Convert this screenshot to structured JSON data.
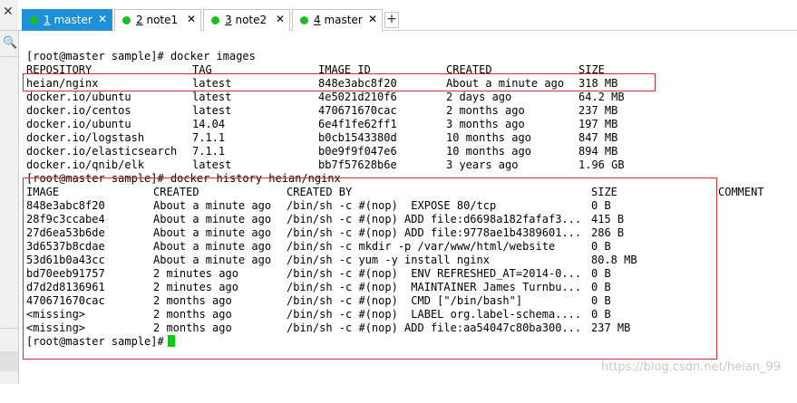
{
  "tabs": [
    {
      "num": "1",
      "name": "master",
      "active": true
    },
    {
      "num": "2",
      "name": "note1",
      "active": false
    },
    {
      "num": "3",
      "name": "note2",
      "active": false
    },
    {
      "num": "4",
      "name": "master",
      "active": false
    }
  ],
  "sidebar": {
    "close_glyph": "✕",
    "search_glyph": "🔍"
  },
  "add_tab_label": "+",
  "terminal": {
    "cmd_images": "[root@master sample]# docker images",
    "images_headers": [
      "REPOSITORY",
      "TAG",
      "IMAGE ID",
      "CREATED",
      "SIZE"
    ],
    "images_rows": [
      [
        "heian/nginx",
        "latest",
        "848e3abc8f20",
        "About a minute ago",
        "318 MB"
      ],
      [
        "docker.io/ubuntu",
        "latest",
        "4e5021d210f6",
        "2 days ago",
        "64.2 MB"
      ],
      [
        "docker.io/centos",
        "latest",
        "470671670cac",
        "2 months ago",
        "237 MB"
      ],
      [
        "docker.io/ubuntu",
        "14.04",
        "6e4f1fe62ff1",
        "3 months ago",
        "197 MB"
      ],
      [
        "docker.io/logstash",
        "7.1.1",
        "b0cb1543380d",
        "10 months ago",
        "847 MB"
      ],
      [
        "docker.io/elasticsearch",
        "7.1.1",
        "b0e9f9f047e6",
        "10 months ago",
        "894 MB"
      ],
      [
        "docker.io/qnib/elk",
        "latest",
        "bb7f57628b6e",
        "3 years ago",
        "1.96 GB"
      ]
    ],
    "cmd_history": "[root@master sample]# docker history heian/nginx",
    "history_headers": [
      "IMAGE",
      "CREATED",
      "CREATED BY",
      "SIZE",
      "COMMENT"
    ],
    "history_rows": [
      [
        "848e3abc8f20",
        "About a minute ago",
        "/bin/sh -c #(nop)  EXPOSE 80/tcp",
        "0 B"
      ],
      [
        "28f9c3ccabe4",
        "About a minute ago",
        "/bin/sh -c #(nop) ADD file:d6698a182fafaf3...",
        "415 B"
      ],
      [
        "27d6ea53b6de",
        "About a minute ago",
        "/bin/sh -c #(nop) ADD file:9778ae1b4389601...",
        "286 B"
      ],
      [
        "3d6537b8cdae",
        "About a minute ago",
        "/bin/sh -c mkdir -p /var/www/html/website",
        "0 B"
      ],
      [
        "53d61b0a43cc",
        "About a minute ago",
        "/bin/sh -c yum -y install nginx",
        "80.8 MB"
      ],
      [
        "bd70eeb91757",
        "2 minutes ago",
        "/bin/sh -c #(nop)  ENV REFRESHED_AT=2014-0...",
        "0 B"
      ],
      [
        "d7d2d8136961",
        "2 minutes ago",
        "/bin/sh -c #(nop)  MAINTAINER James Turnbu...",
        "0 B"
      ],
      [
        "470671670cac",
        "2 months ago",
        "/bin/sh -c #(nop)  CMD [\"/bin/bash\"]",
        "0 B"
      ],
      [
        "<missing>",
        "2 months ago",
        "/bin/sh -c #(nop)  LABEL org.label-schema....",
        "0 B"
      ],
      [
        "<missing>",
        "2 months ago",
        "/bin/sh -c #(nop) ADD file:aa54047c80ba300...",
        "237 MB"
      ]
    ],
    "prompt": "[root@master sample]#"
  },
  "watermark": "https://blog.csdn.net/heian_99",
  "colors": {
    "active_tab": "#1e90d8",
    "status_dot": "#18c018",
    "highlight_box": "#d03030",
    "cursor": "#00d000"
  }
}
